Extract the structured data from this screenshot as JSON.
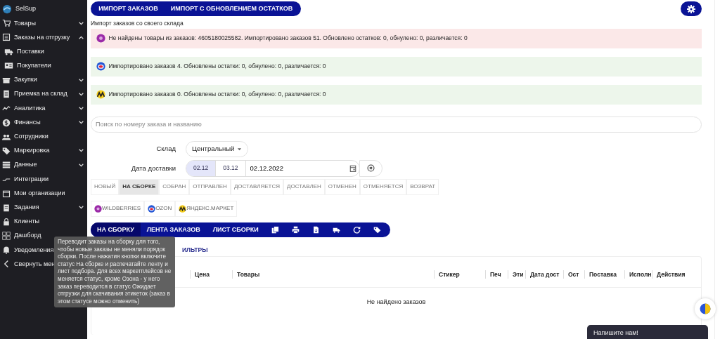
{
  "sidebar": {
    "logo": "SelSup",
    "items": [
      {
        "label": "Товары",
        "kind": "group",
        "expanded": false
      },
      {
        "label": "Заказы на отгрузку",
        "kind": "group",
        "expanded": true,
        "children": [
          {
            "label": "Поставки"
          },
          {
            "label": "Покупатели"
          }
        ]
      },
      {
        "label": "Закупки",
        "kind": "group",
        "expanded": false
      },
      {
        "label": "Приемка на склад",
        "kind": "group",
        "expanded": false
      },
      {
        "label": "Аналитика",
        "kind": "group",
        "expanded": false
      },
      {
        "label": "Финансы",
        "kind": "group",
        "expanded": false
      },
      {
        "label": "Сотрудники",
        "kind": "link"
      },
      {
        "label": "Маркировка",
        "kind": "group",
        "expanded": false
      },
      {
        "label": "Данные",
        "kind": "group",
        "expanded": false
      },
      {
        "label": "Интеграции",
        "kind": "link"
      },
      {
        "label": "Мои организации",
        "kind": "link"
      },
      {
        "label": "Задания",
        "kind": "group",
        "expanded": false
      },
      {
        "label": "Клиенты",
        "kind": "link"
      },
      {
        "label": "Дашборд",
        "kind": "link"
      },
      {
        "label": "Уведомления",
        "kind": "link"
      },
      {
        "label": "Свернуть мен",
        "kind": "collapse"
      }
    ]
  },
  "import_buttons": [
    "ИМПОРТ ЗАКАЗОВ",
    "ИМПОРТ С ОБНОВЛЕНИЕМ ОСТАТКОВ"
  ],
  "import_caption": "Импорт заказов со своего склада",
  "alerts": [
    {
      "kind": "error",
      "text": "Не найдены товары из заказов: 4605180025582. Импортировано заказов 51. Обновлено остатков: 0, обнулено: 0, различается: 0"
    },
    {
      "kind": "success",
      "text": "Импортировано заказов 4. Обновлены остатки: 0, обнулено: 0, различается: 0"
    },
    {
      "kind": "success",
      "text": "Импортировано заказов 0. Обновлены остатки: 0, обнулено: 0, различается: 0"
    }
  ],
  "search": {
    "placeholder": "Поиск по номеру заказа и названию"
  },
  "warehouse": {
    "label": "Склад",
    "value": "Центральный"
  },
  "delivery_date": {
    "label": "Дата доставки",
    "presets": [
      {
        "label": "02.12",
        "selected": true
      },
      {
        "label": "03.12",
        "selected": false
      }
    ],
    "value": "02.12.2022"
  },
  "status_tabs": [
    {
      "label": "НОВЫЙ",
      "selected": false
    },
    {
      "label": "НА СБОРКЕ",
      "selected": true
    },
    {
      "label": "СОБРАН",
      "selected": false
    },
    {
      "label": "ОТПРАВЛЕН",
      "selected": false
    },
    {
      "label": "ДОСТАВЛЯЕТСЯ",
      "selected": false
    },
    {
      "label": "ДОСТАВЛЕН",
      "selected": false
    },
    {
      "label": "ОТМЕНЕН",
      "selected": false
    },
    {
      "label": "ОТМЕНЯЕТСЯ",
      "selected": false
    },
    {
      "label": "ВОЗВРАТ",
      "selected": false
    }
  ],
  "marketplaces": [
    {
      "label": "WILDBERRIES"
    },
    {
      "label": "OZON"
    },
    {
      "label": "ЯНДЕКС.МАРКЕТ"
    }
  ],
  "actions": [
    {
      "label": "НА СБОРКУ",
      "hovered": true
    },
    {
      "label": "ЛЕНТА ЗАКАЗОВ",
      "hovered": false
    },
    {
      "label": "ЛИСТ СБОРКИ",
      "hovered": false
    }
  ],
  "filters_link": "ИЛЬТРЫ",
  "table": {
    "columns": [
      "Цена",
      "Товары",
      "Стикер",
      "Печ",
      "Эти",
      "Дата дост",
      "Ост",
      "Поставка",
      "Исполн",
      "Действия"
    ],
    "empty_message": "Не найдено заказов"
  },
  "tooltip": "Переводит заказы на сборку для того, чтобы новые заказы не меняли порядок сборки. После нажатия кнопки включите статус На сборке и распечатайте ленту и лист подбора. Для всех маркетплейсов не меняется статус, кроме Озона - у него заказ переводится в статус Ожидает отгрузки для скачивания этикеток (заказ в этом статусе можно отменить)",
  "chat_widget": "Напишите нам!"
}
